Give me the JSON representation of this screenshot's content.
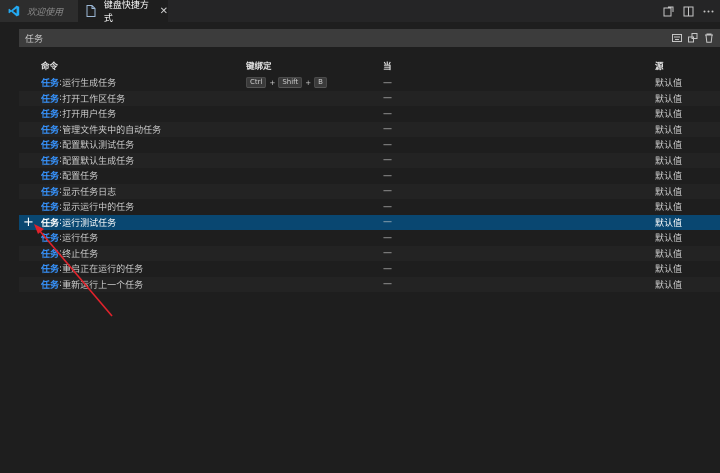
{
  "tabs": [
    {
      "label": "欢迎使用",
      "icon": "vscode-logo-icon"
    },
    {
      "label": "键盘快捷方式",
      "icon": "file-icon",
      "close": "✕"
    }
  ],
  "search": {
    "value": "任务"
  },
  "columns": {
    "command": "命令",
    "keybinding": "键绑定",
    "when": "当",
    "source": "源"
  },
  "rows": [
    {
      "category": "任务",
      "name": "运行生成任务",
      "keys": [
        "Ctrl",
        "Shift",
        "B"
      ],
      "when": "—",
      "source": "默认值"
    },
    {
      "category": "任务",
      "name": "打开工作区任务",
      "when": "—",
      "source": "默认值"
    },
    {
      "category": "任务",
      "name": "打开用户任务",
      "when": "—",
      "source": "默认值"
    },
    {
      "category": "任务",
      "name": "管理文件夹中的自动任务",
      "when": "—",
      "source": "默认值"
    },
    {
      "category": "任务",
      "name": "配置默认测试任务",
      "when": "—",
      "source": "默认值"
    },
    {
      "category": "任务",
      "name": "配置默认生成任务",
      "when": "—",
      "source": "默认值"
    },
    {
      "category": "任务",
      "name": "配置任务",
      "when": "—",
      "source": "默认值"
    },
    {
      "category": "任务",
      "name": "显示任务日志",
      "when": "—",
      "source": "默认值"
    },
    {
      "category": "任务",
      "name": "显示运行中的任务",
      "when": "—",
      "source": "默认值"
    },
    {
      "category": "任务",
      "name": "运行测试任务",
      "when": "—",
      "source": "默认值",
      "selected": true,
      "add": "+"
    },
    {
      "category": "任务",
      "name": "运行任务",
      "when": "—",
      "source": "默认值"
    },
    {
      "category": "任务",
      "name": "终止任务",
      "when": "—",
      "source": "默认值"
    },
    {
      "category": "任务",
      "name": "重启正在运行的任务",
      "when": "—",
      "source": "默认值"
    },
    {
      "category": "任务",
      "name": "重新运行上一个任务",
      "when": "—",
      "source": "默认值"
    }
  ],
  "colors": {
    "accent": "#3794ff",
    "selection": "#094771",
    "arrow": "#e0222b"
  }
}
